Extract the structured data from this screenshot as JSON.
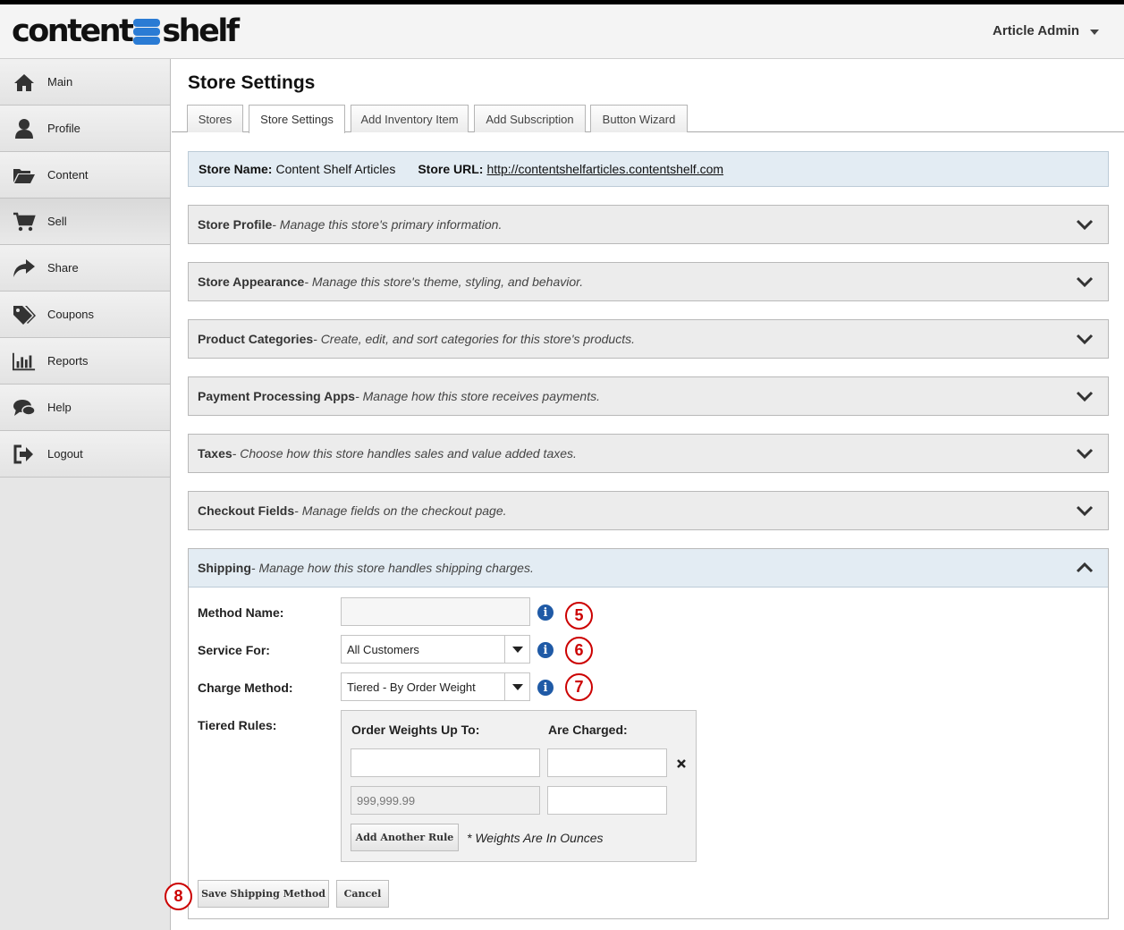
{
  "app": {
    "logo_left": "content",
    "logo_right": "shelf",
    "user_name": "Article Admin"
  },
  "sidebar": {
    "items": [
      {
        "label": "Main",
        "icon": "home-icon"
      },
      {
        "label": "Profile",
        "icon": "user-icon"
      },
      {
        "label": "Content",
        "icon": "folder-icon"
      },
      {
        "label": "Sell",
        "icon": "cart-icon"
      },
      {
        "label": "Share",
        "icon": "share-icon"
      },
      {
        "label": "Coupons",
        "icon": "tags-icon"
      },
      {
        "label": "Reports",
        "icon": "bar-chart-icon"
      },
      {
        "label": "Help",
        "icon": "chat-icon"
      },
      {
        "label": "Logout",
        "icon": "logout-icon"
      }
    ],
    "active": "Sell"
  },
  "page": {
    "title": "Store Settings",
    "tabs": [
      "Stores",
      "Store Settings",
      "Add Inventory Item",
      "Add Subscription",
      "Button Wizard"
    ],
    "active_tab": "Store Settings"
  },
  "store_info": {
    "name_label": "Store Name:",
    "name_value": "Content Shelf Articles",
    "url_label": "Store URL:",
    "url_value": "http://contentshelfarticles.contentshelf.com"
  },
  "panels": [
    {
      "title": "Store Profile",
      "desc": " - Manage this store's primary information."
    },
    {
      "title": "Store Appearance",
      "desc": " - Manage this store's theme, styling, and behavior."
    },
    {
      "title": "Product Categories",
      "desc": " - Create, edit, and sort categories for this store's products."
    },
    {
      "title": "Payment Processing Apps",
      "desc": " - Manage how this store receives payments."
    },
    {
      "title": "Taxes",
      "desc": " - Choose how this store handles sales and value added taxes."
    },
    {
      "title": "Checkout Fields",
      "desc": " - Manage fields on the checkout page."
    }
  ],
  "shipping": {
    "title": "Shipping",
    "desc": " - Manage how this store handles shipping charges.",
    "method_name_label": "Method Name:",
    "method_name_value": "",
    "service_for_label": "Service For:",
    "service_for_value": "All Customers",
    "charge_method_label": "Charge Method:",
    "charge_method_value": "Tiered - By Order Weight",
    "tiered_rules_label": "Tiered Rules:",
    "col_weights": "Order Weights Up To:",
    "col_charged": "Are Charged:",
    "last_weight_placeholder": "999,999.99",
    "add_rule_label": "Add Another Rule",
    "weights_note": "* Weights Are In Ounces",
    "save_label": "Save Shipping Method",
    "cancel_label": "Cancel",
    "callouts": [
      "5",
      "6",
      "7",
      "8"
    ]
  },
  "colors": {
    "accent_blue": "#2a7bd4",
    "info_icon": "#1f5aa6",
    "callout_red": "#cc0000",
    "header_panel_blue": "#e3ecf3"
  }
}
